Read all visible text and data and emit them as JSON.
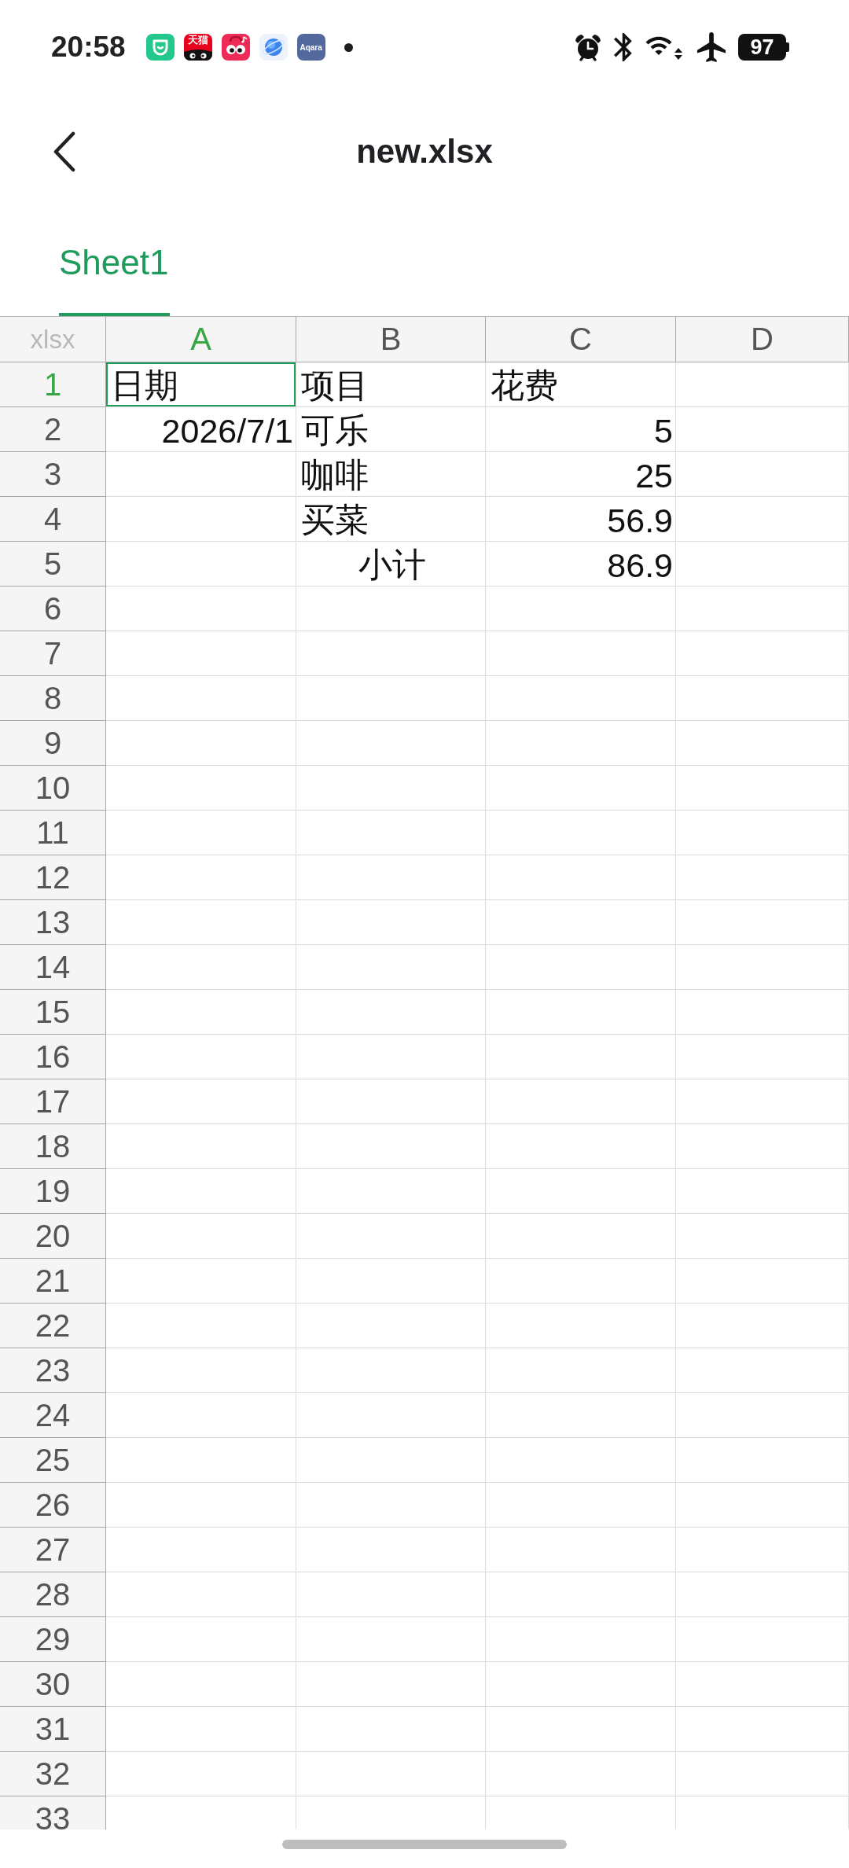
{
  "status_bar": {
    "time": "20:58",
    "app_icons": [
      {
        "kind": "smile"
      },
      {
        "kind": "cat",
        "label": "天猫"
      },
      {
        "kind": "eyes"
      },
      {
        "kind": "planet"
      },
      {
        "kind": "tile",
        "label": "Aqara"
      }
    ],
    "battery": "97"
  },
  "header": {
    "title": "new.xlsx"
  },
  "tabs": [
    {
      "label": "Sheet1",
      "selected": true
    }
  ],
  "sheet": {
    "corner": "xlsx",
    "columns": [
      {
        "label": "A",
        "selected": true
      },
      {
        "label": "B",
        "selected": false
      },
      {
        "label": "C",
        "selected": false
      },
      {
        "label": "D",
        "selected": false
      }
    ],
    "rows": [
      {
        "number": "1",
        "selected": true,
        "cells": [
          {
            "kind": "text",
            "text": "日期",
            "selected": true
          },
          {
            "kind": "text",
            "text": "项目",
            "selected": false
          },
          {
            "kind": "text",
            "text": "花费",
            "selected": false
          }
        ]
      },
      {
        "number": "2",
        "selected": false,
        "cells": [
          {
            "kind": "number",
            "text": "2026/7/1",
            "selected": false
          },
          {
            "kind": "text",
            "text": "可乐",
            "selected": false
          },
          {
            "kind": "number",
            "text": "5",
            "selected": false
          }
        ]
      },
      {
        "number": "3",
        "selected": false,
        "cells": [
          {
            "kind": "empty",
            "selected": false
          },
          {
            "kind": "text",
            "text": "咖啡",
            "selected": false
          },
          {
            "kind": "number",
            "text": "25",
            "selected": false
          }
        ]
      },
      {
        "number": "4",
        "selected": false,
        "cells": [
          {
            "kind": "empty",
            "selected": false
          },
          {
            "kind": "text",
            "text": "买菜",
            "selected": false
          },
          {
            "kind": "number",
            "text": "56.9",
            "selected": false
          }
        ]
      },
      {
        "number": "5",
        "selected": false,
        "cells": [
          {
            "kind": "empty",
            "selected": false
          },
          {
            "kind": "centered",
            "text": "小计",
            "selected": false
          },
          {
            "kind": "number",
            "text": "86.9",
            "selected": false
          }
        ]
      },
      {
        "number": "6",
        "selected": false
      },
      {
        "number": "7",
        "selected": false
      },
      {
        "number": "8",
        "selected": false
      },
      {
        "number": "9",
        "selected": false
      },
      {
        "number": "10",
        "selected": false
      },
      {
        "number": "11",
        "selected": false
      },
      {
        "number": "12",
        "selected": false
      },
      {
        "number": "13",
        "selected": false
      },
      {
        "number": "14",
        "selected": false
      },
      {
        "number": "15",
        "selected": false
      },
      {
        "number": "16",
        "selected": false
      },
      {
        "number": "17",
        "selected": false
      },
      {
        "number": "18",
        "selected": false
      },
      {
        "number": "19",
        "selected": false
      },
      {
        "number": "20",
        "selected": false
      },
      {
        "number": "21",
        "selected": false
      },
      {
        "number": "22",
        "selected": false
      },
      {
        "number": "23",
        "selected": false
      },
      {
        "number": "24",
        "selected": false
      },
      {
        "number": "25",
        "selected": false
      },
      {
        "number": "26",
        "selected": false
      },
      {
        "number": "27",
        "selected": false
      },
      {
        "number": "28",
        "selected": false
      },
      {
        "number": "29",
        "selected": false
      },
      {
        "number": "30",
        "selected": false
      },
      {
        "number": "31",
        "selected": false
      },
      {
        "number": "32",
        "selected": false
      },
      {
        "number": "33",
        "selected": false
      }
    ]
  }
}
